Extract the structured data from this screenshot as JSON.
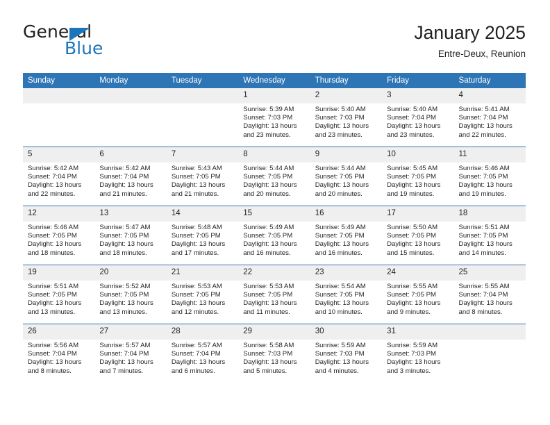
{
  "brand": {
    "name_top": "General",
    "name_bottom": "Blue",
    "accent_color": "#1b75bb"
  },
  "header": {
    "title": "January 2025",
    "location": "Entre-Deux, Reunion"
  },
  "theme": {
    "header_bg": "#2e75b6",
    "daynum_bg": "#efefef",
    "text": "#231f20"
  },
  "weekday_headers": [
    "Sunday",
    "Monday",
    "Tuesday",
    "Wednesday",
    "Thursday",
    "Friday",
    "Saturday"
  ],
  "weeks": [
    [
      {
        "day": "",
        "sunrise": "",
        "sunset": "",
        "daylight_1": "",
        "daylight_2": "",
        "empty": true
      },
      {
        "day": "",
        "sunrise": "",
        "sunset": "",
        "daylight_1": "",
        "daylight_2": "",
        "empty": true
      },
      {
        "day": "",
        "sunrise": "",
        "sunset": "",
        "daylight_1": "",
        "daylight_2": "",
        "empty": true
      },
      {
        "day": "1",
        "sunrise": "Sunrise: 5:39 AM",
        "sunset": "Sunset: 7:03 PM",
        "daylight_1": "Daylight: 13 hours",
        "daylight_2": "and 23 minutes."
      },
      {
        "day": "2",
        "sunrise": "Sunrise: 5:40 AM",
        "sunset": "Sunset: 7:03 PM",
        "daylight_1": "Daylight: 13 hours",
        "daylight_2": "and 23 minutes."
      },
      {
        "day": "3",
        "sunrise": "Sunrise: 5:40 AM",
        "sunset": "Sunset: 7:04 PM",
        "daylight_1": "Daylight: 13 hours",
        "daylight_2": "and 23 minutes."
      },
      {
        "day": "4",
        "sunrise": "Sunrise: 5:41 AM",
        "sunset": "Sunset: 7:04 PM",
        "daylight_1": "Daylight: 13 hours",
        "daylight_2": "and 22 minutes."
      }
    ],
    [
      {
        "day": "5",
        "sunrise": "Sunrise: 5:42 AM",
        "sunset": "Sunset: 7:04 PM",
        "daylight_1": "Daylight: 13 hours",
        "daylight_2": "and 22 minutes."
      },
      {
        "day": "6",
        "sunrise": "Sunrise: 5:42 AM",
        "sunset": "Sunset: 7:04 PM",
        "daylight_1": "Daylight: 13 hours",
        "daylight_2": "and 21 minutes."
      },
      {
        "day": "7",
        "sunrise": "Sunrise: 5:43 AM",
        "sunset": "Sunset: 7:05 PM",
        "daylight_1": "Daylight: 13 hours",
        "daylight_2": "and 21 minutes."
      },
      {
        "day": "8",
        "sunrise": "Sunrise: 5:44 AM",
        "sunset": "Sunset: 7:05 PM",
        "daylight_1": "Daylight: 13 hours",
        "daylight_2": "and 20 minutes."
      },
      {
        "day": "9",
        "sunrise": "Sunrise: 5:44 AM",
        "sunset": "Sunset: 7:05 PM",
        "daylight_1": "Daylight: 13 hours",
        "daylight_2": "and 20 minutes."
      },
      {
        "day": "10",
        "sunrise": "Sunrise: 5:45 AM",
        "sunset": "Sunset: 7:05 PM",
        "daylight_1": "Daylight: 13 hours",
        "daylight_2": "and 19 minutes."
      },
      {
        "day": "11",
        "sunrise": "Sunrise: 5:46 AM",
        "sunset": "Sunset: 7:05 PM",
        "daylight_1": "Daylight: 13 hours",
        "daylight_2": "and 19 minutes."
      }
    ],
    [
      {
        "day": "12",
        "sunrise": "Sunrise: 5:46 AM",
        "sunset": "Sunset: 7:05 PM",
        "daylight_1": "Daylight: 13 hours",
        "daylight_2": "and 18 minutes."
      },
      {
        "day": "13",
        "sunrise": "Sunrise: 5:47 AM",
        "sunset": "Sunset: 7:05 PM",
        "daylight_1": "Daylight: 13 hours",
        "daylight_2": "and 18 minutes."
      },
      {
        "day": "14",
        "sunrise": "Sunrise: 5:48 AM",
        "sunset": "Sunset: 7:05 PM",
        "daylight_1": "Daylight: 13 hours",
        "daylight_2": "and 17 minutes."
      },
      {
        "day": "15",
        "sunrise": "Sunrise: 5:49 AM",
        "sunset": "Sunset: 7:05 PM",
        "daylight_1": "Daylight: 13 hours",
        "daylight_2": "and 16 minutes."
      },
      {
        "day": "16",
        "sunrise": "Sunrise: 5:49 AM",
        "sunset": "Sunset: 7:05 PM",
        "daylight_1": "Daylight: 13 hours",
        "daylight_2": "and 16 minutes."
      },
      {
        "day": "17",
        "sunrise": "Sunrise: 5:50 AM",
        "sunset": "Sunset: 7:05 PM",
        "daylight_1": "Daylight: 13 hours",
        "daylight_2": "and 15 minutes."
      },
      {
        "day": "18",
        "sunrise": "Sunrise: 5:51 AM",
        "sunset": "Sunset: 7:05 PM",
        "daylight_1": "Daylight: 13 hours",
        "daylight_2": "and 14 minutes."
      }
    ],
    [
      {
        "day": "19",
        "sunrise": "Sunrise: 5:51 AM",
        "sunset": "Sunset: 7:05 PM",
        "daylight_1": "Daylight: 13 hours",
        "daylight_2": "and 13 minutes."
      },
      {
        "day": "20",
        "sunrise": "Sunrise: 5:52 AM",
        "sunset": "Sunset: 7:05 PM",
        "daylight_1": "Daylight: 13 hours",
        "daylight_2": "and 13 minutes."
      },
      {
        "day": "21",
        "sunrise": "Sunrise: 5:53 AM",
        "sunset": "Sunset: 7:05 PM",
        "daylight_1": "Daylight: 13 hours",
        "daylight_2": "and 12 minutes."
      },
      {
        "day": "22",
        "sunrise": "Sunrise: 5:53 AM",
        "sunset": "Sunset: 7:05 PM",
        "daylight_1": "Daylight: 13 hours",
        "daylight_2": "and 11 minutes."
      },
      {
        "day": "23",
        "sunrise": "Sunrise: 5:54 AM",
        "sunset": "Sunset: 7:05 PM",
        "daylight_1": "Daylight: 13 hours",
        "daylight_2": "and 10 minutes."
      },
      {
        "day": "24",
        "sunrise": "Sunrise: 5:55 AM",
        "sunset": "Sunset: 7:05 PM",
        "daylight_1": "Daylight: 13 hours",
        "daylight_2": "and 9 minutes."
      },
      {
        "day": "25",
        "sunrise": "Sunrise: 5:55 AM",
        "sunset": "Sunset: 7:04 PM",
        "daylight_1": "Daylight: 13 hours",
        "daylight_2": "and 8 minutes."
      }
    ],
    [
      {
        "day": "26",
        "sunrise": "Sunrise: 5:56 AM",
        "sunset": "Sunset: 7:04 PM",
        "daylight_1": "Daylight: 13 hours",
        "daylight_2": "and 8 minutes."
      },
      {
        "day": "27",
        "sunrise": "Sunrise: 5:57 AM",
        "sunset": "Sunset: 7:04 PM",
        "daylight_1": "Daylight: 13 hours",
        "daylight_2": "and 7 minutes."
      },
      {
        "day": "28",
        "sunrise": "Sunrise: 5:57 AM",
        "sunset": "Sunset: 7:04 PM",
        "daylight_1": "Daylight: 13 hours",
        "daylight_2": "and 6 minutes."
      },
      {
        "day": "29",
        "sunrise": "Sunrise: 5:58 AM",
        "sunset": "Sunset: 7:03 PM",
        "daylight_1": "Daylight: 13 hours",
        "daylight_2": "and 5 minutes."
      },
      {
        "day": "30",
        "sunrise": "Sunrise: 5:59 AM",
        "sunset": "Sunset: 7:03 PM",
        "daylight_1": "Daylight: 13 hours",
        "daylight_2": "and 4 minutes."
      },
      {
        "day": "31",
        "sunrise": "Sunrise: 5:59 AM",
        "sunset": "Sunset: 7:03 PM",
        "daylight_1": "Daylight: 13 hours",
        "daylight_2": "and 3 minutes."
      },
      {
        "day": "",
        "sunrise": "",
        "sunset": "",
        "daylight_1": "",
        "daylight_2": "",
        "empty": true
      }
    ]
  ]
}
